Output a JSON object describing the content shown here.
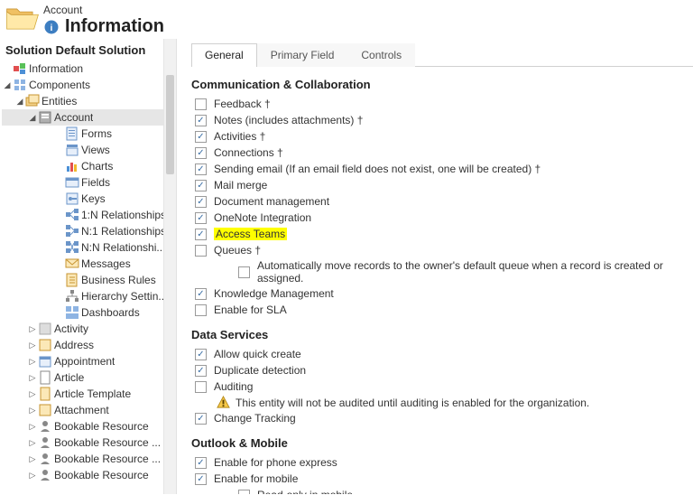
{
  "header": {
    "breadcrumb": "Account",
    "title": "Information"
  },
  "sidebar": {
    "title": "Solution Default Solution",
    "information": "Information",
    "components": "Components",
    "entities": "Entities",
    "account": "Account",
    "account_children": {
      "forms": "Forms",
      "views": "Views",
      "charts": "Charts",
      "fields": "Fields",
      "keys": "Keys",
      "rel_1n": "1:N Relationships",
      "rel_n1": "N:1 Relationships",
      "rel_nn": "N:N Relationshi...",
      "messages": "Messages",
      "business_rules": "Business Rules",
      "hierarchy": "Hierarchy Settin...",
      "dashboards": "Dashboards"
    },
    "siblings": {
      "activity": "Activity",
      "address": "Address",
      "appointment": "Appointment",
      "article": "Article",
      "article_template": "Article Template",
      "attachment": "Attachment",
      "bookable_resource": "Bookable Resource",
      "bookable_resource_2": "Bookable Resource ...",
      "bookable_resource_3": "Bookable Resource ...",
      "bookable_resource_4": "Bookable Resource"
    }
  },
  "tabs": {
    "general": "General",
    "primary_field": "Primary Field",
    "controls": "Controls"
  },
  "sections": {
    "comm": "Communication & Collaboration",
    "data_services": "Data Services",
    "outlook": "Outlook & Mobile"
  },
  "options": {
    "feedback": "Feedback †",
    "notes": "Notes (includes attachments) †",
    "activities": "Activities †",
    "connections": "Connections †",
    "sending_email": "Sending email (If an email field does not exist, one will be created) †",
    "mail_merge": "Mail merge",
    "doc_mgmt": "Document management",
    "onenote": "OneNote Integration",
    "access_teams": "Access Teams",
    "queues": "Queues †",
    "auto_queue": "Automatically move records to the owner's default queue when a record is created or assigned.",
    "knowledge": "Knowledge Management",
    "enable_sla": "Enable for SLA",
    "allow_quick_create": "Allow quick create",
    "dup_detect": "Duplicate detection",
    "auditing": "Auditing",
    "audit_warn": "This entity will not be audited until auditing is enabled for the organization.",
    "change_tracking": "Change Tracking",
    "phone_express": "Enable for phone express",
    "mobile": "Enable for mobile",
    "read_only_mobile": "Read-only in mobile"
  }
}
